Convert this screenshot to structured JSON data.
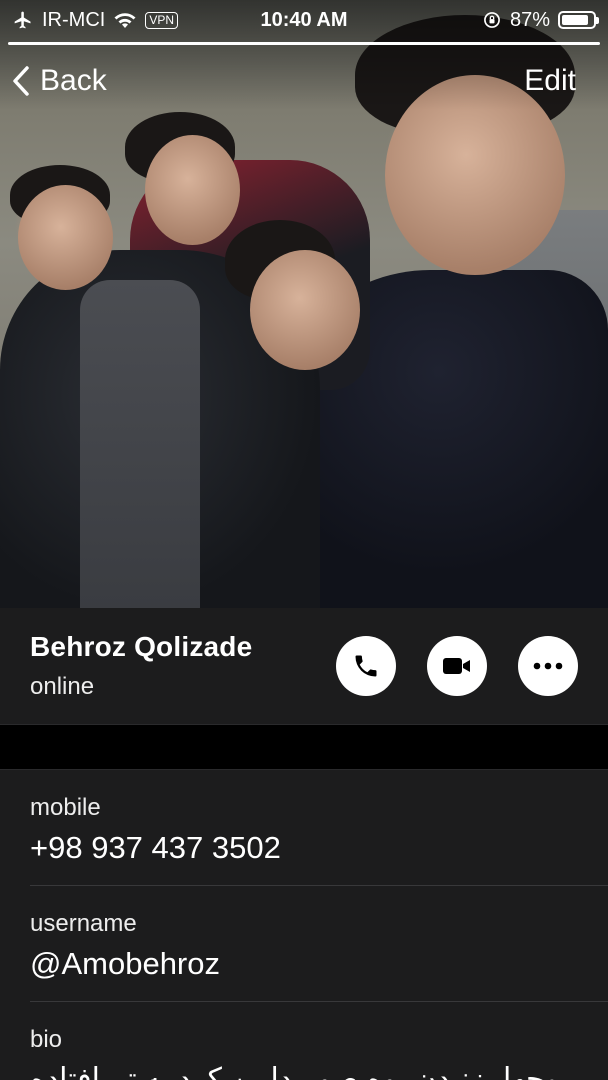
{
  "status_bar": {
    "carrier": "IR-MCI",
    "vpn": "VPN",
    "time": "10:40 AM",
    "battery": "87%",
    "battery_level": 0.87
  },
  "nav": {
    "back_label": "Back",
    "edit_label": "Edit"
  },
  "profile": {
    "name": "Behroz Qolizade",
    "status": "online"
  },
  "info": {
    "mobile_label": "mobile",
    "mobile_value": "+98 937 437 3502",
    "username_label": "username",
    "username_value": "@Amobehroz",
    "bio_label": "bio",
    "bio_value": "روحها بزنیدن پوه صوریدایپن کرد به تم افتاده"
  },
  "icons": [
    "airplane-icon",
    "wifi-icon",
    "rotation-lock-icon",
    "battery-icon",
    "chevron-left-icon",
    "phone-icon",
    "video-icon",
    "more-icon"
  ]
}
